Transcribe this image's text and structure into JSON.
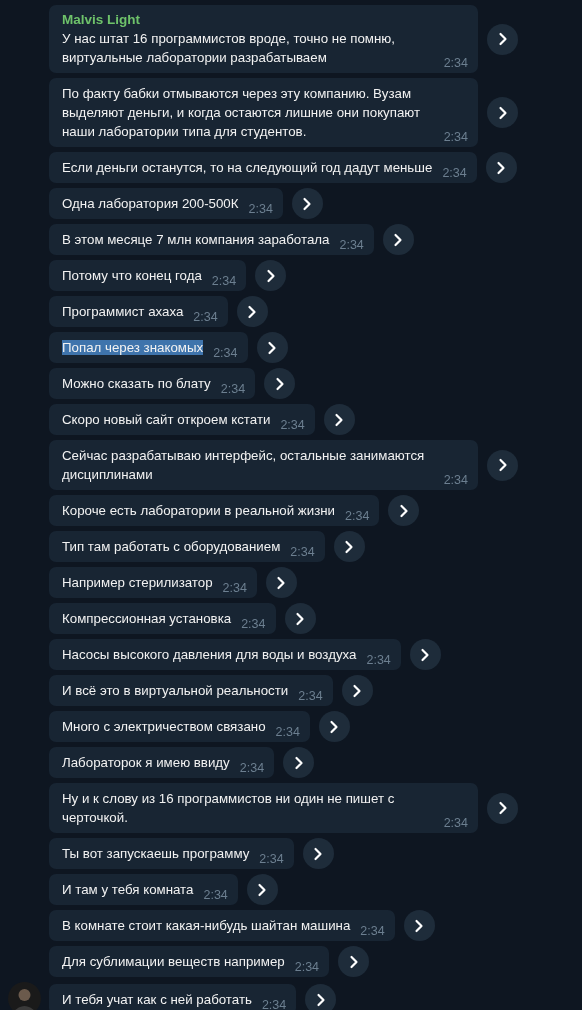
{
  "messages": [
    {
      "sender": "Malvis Light",
      "text": "У нас штат 16 программистов вроде, точно не помню, виртуальные лаборатории разрабатываем",
      "time": "2:34",
      "selected": false,
      "show_avatar": false
    },
    {
      "text": "По факту бабки отмываются через эту компанию. Вузам выделяют деньги, и когда остаются лишние они покупают наши лаборатории типа для студентов.",
      "time": "2:34",
      "selected": false,
      "show_avatar": false
    },
    {
      "text": "Если деньги останутся, то на следующий год дадут меньше",
      "time": "2:34",
      "selected": false,
      "show_avatar": false
    },
    {
      "text": "Одна лаборатория 200-500К",
      "time": "2:34",
      "selected": false,
      "show_avatar": false
    },
    {
      "text": "В этом месяце 7 млн компания заработала",
      "time": "2:34",
      "selected": false,
      "show_avatar": false
    },
    {
      "text": "Потому что конец года",
      "time": "2:34",
      "selected": false,
      "show_avatar": false
    },
    {
      "text": "Программист ахаха",
      "time": "2:34",
      "selected": false,
      "show_avatar": false
    },
    {
      "text": "Попал через знакомых",
      "time": "2:34",
      "selected": true,
      "show_avatar": false
    },
    {
      "text": "Можно сказать по блату",
      "time": "2:34",
      "selected": false,
      "show_avatar": false
    },
    {
      "text": "Скоро новый сайт откроем кстати",
      "time": "2:34",
      "selected": false,
      "show_avatar": false
    },
    {
      "text": "Сейчас разрабатываю интерфейс, остальные занимаются дисциплинами",
      "time": "2:34",
      "selected": false,
      "show_avatar": false
    },
    {
      "text": "Короче есть лаборатории в реальной жизни",
      "time": "2:34",
      "selected": false,
      "show_avatar": false
    },
    {
      "text": "Тип там работать с оборудованием",
      "time": "2:34",
      "selected": false,
      "show_avatar": false
    },
    {
      "text": "Например стерилизатор",
      "time": "2:34",
      "selected": false,
      "show_avatar": false
    },
    {
      "text": "Компрессионная установка",
      "time": "2:34",
      "selected": false,
      "show_avatar": false
    },
    {
      "text": "Насосы высокого давления для воды и воздуха",
      "time": "2:34",
      "selected": false,
      "show_avatar": false
    },
    {
      "text": "И всё это в виртуальной реальности",
      "time": "2:34",
      "selected": false,
      "show_avatar": false
    },
    {
      "text": "Много с электричеством связано",
      "time": "2:34",
      "selected": false,
      "show_avatar": false
    },
    {
      "text": "Лабораторок я имею ввиду",
      "time": "2:34",
      "selected": false,
      "show_avatar": false
    },
    {
      "text": "Ну и к слову из 16 программистов ни один не пишет с черточкой.",
      "time": "2:34",
      "selected": false,
      "show_avatar": false
    },
    {
      "text": "Ты вот запускаешь программу",
      "time": "2:34",
      "selected": false,
      "show_avatar": false
    },
    {
      "text": "И там у тебя комната",
      "time": "2:34",
      "selected": false,
      "show_avatar": false
    },
    {
      "text": "В комнате стоит какая-нибудь шайтан машина",
      "time": "2:34",
      "selected": false,
      "show_avatar": false
    },
    {
      "text": "Для сублимации веществ например",
      "time": "2:34",
      "selected": false,
      "show_avatar": false
    },
    {
      "text": "И тебя учат как с ней работать",
      "time": "2:34",
      "selected": false,
      "show_avatar": true
    }
  ]
}
